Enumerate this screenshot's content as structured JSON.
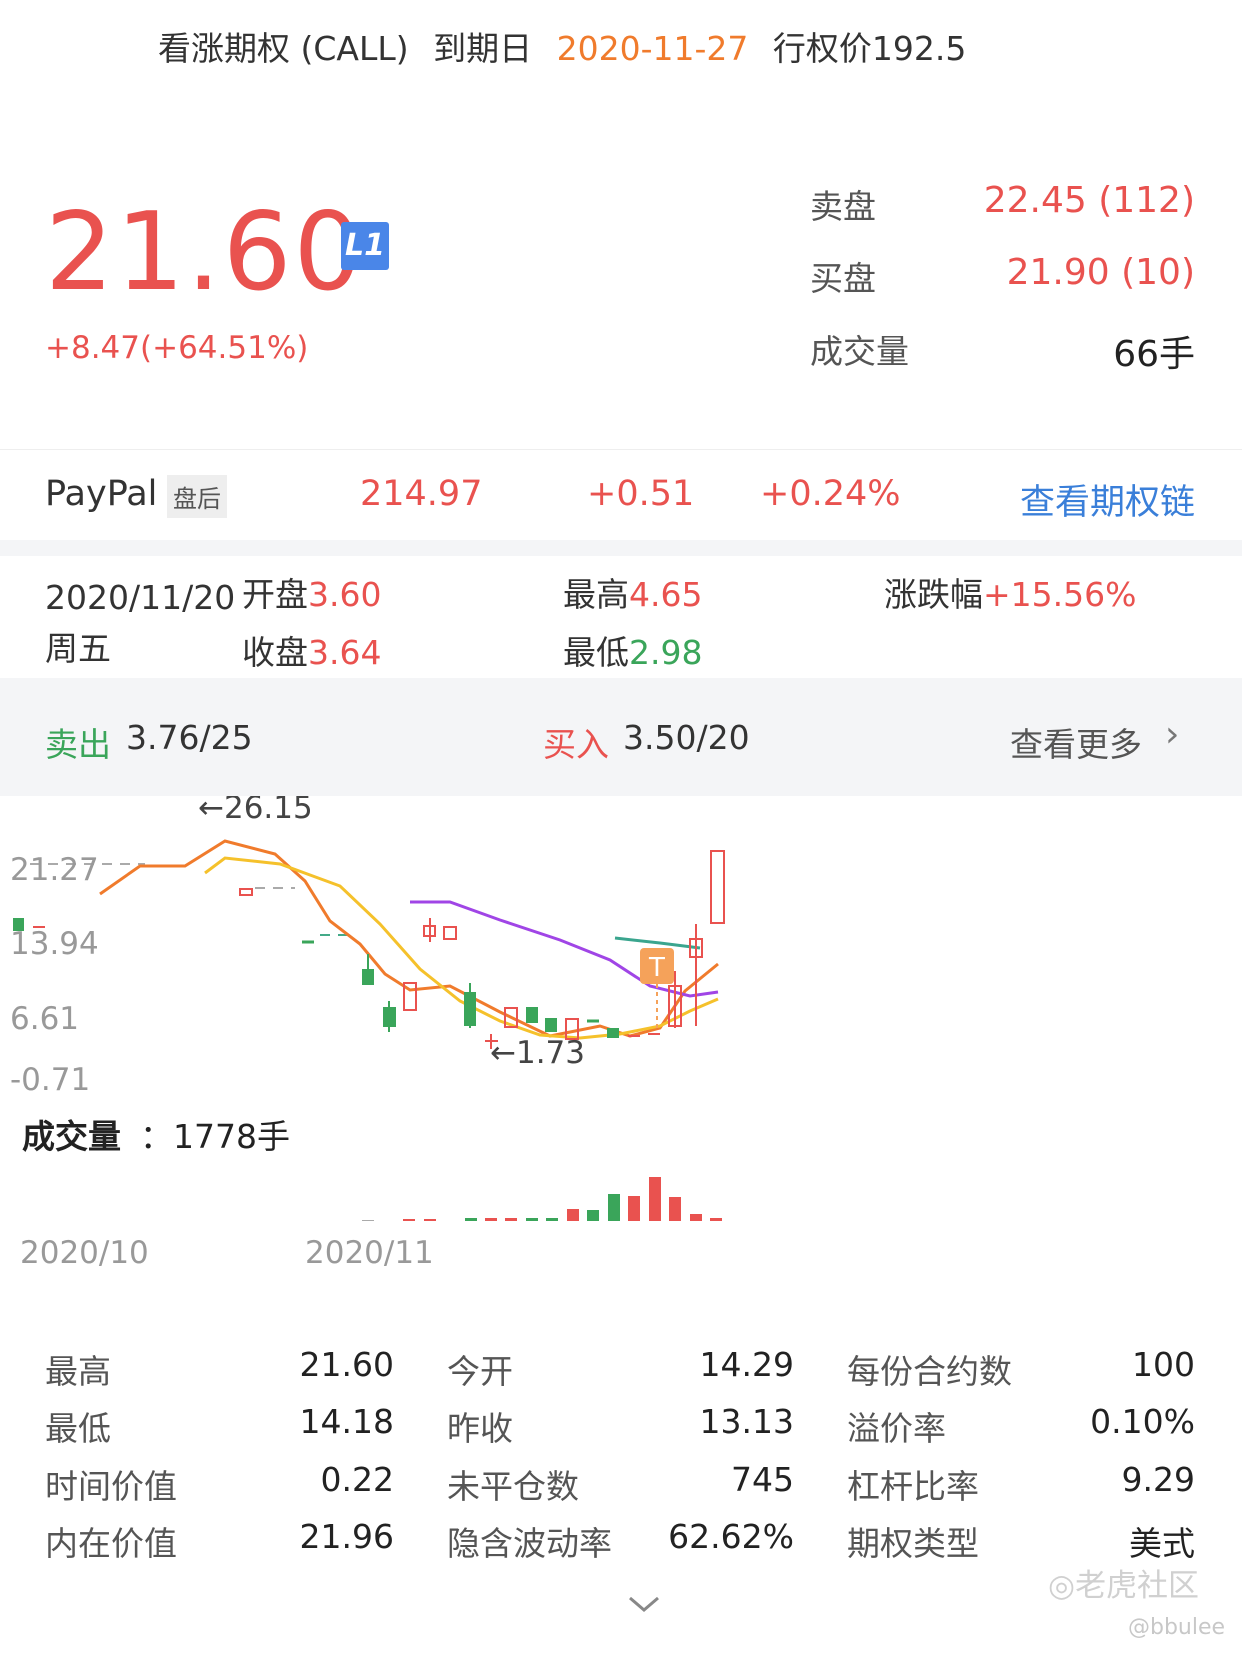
{
  "header": {
    "type_label": "看涨期权 (CALL)",
    "expiry_label": "到期日",
    "expiry_date": "2020-11-27",
    "strike_label": "行权价192.5"
  },
  "quote": {
    "price": "21.60",
    "level_badge": "L1",
    "change": "+8.47(+64.51%)",
    "ask_label": "卖盘",
    "ask_value": "22.45 (112)",
    "bid_label": "买盘",
    "bid_value": "21.90 (10)",
    "volume_label": "成交量",
    "volume_value": "66手"
  },
  "underlying": {
    "name": "PayPal",
    "session_badge": "盘后",
    "price": "214.97",
    "change": "+0.51",
    "change_pct": "+0.24%",
    "chain_link": "查看期权链"
  },
  "daily": {
    "date": "2020/11/20",
    "weekday": "周五",
    "open_label": "开盘",
    "open_value": "3.60",
    "close_label": "收盘",
    "close_value": "3.64",
    "high_label": "最高",
    "high_value": "4.65",
    "low_label": "最低",
    "low_value": "2.98",
    "range_label": "涨跌幅",
    "range_value": "+15.56%"
  },
  "orders": {
    "sell_label": "卖出",
    "sell_value": "3.76/25",
    "buy_label": "买入",
    "buy_value": "3.50/20",
    "more_label": "查看更多"
  },
  "chart": {
    "y_ticks": [
      "21.27",
      "13.94",
      "6.61",
      "-0.71"
    ],
    "max_annotation": "←26.15",
    "min_annotation": "←1.73",
    "trade_marker": "T",
    "volume_label": "成交量",
    "volume_value": "：1778手",
    "x_ticks": [
      "2020/10",
      "2020/11"
    ]
  },
  "chart_data": {
    "type": "candlestick",
    "y_ticks": [
      21.27,
      13.94,
      6.61,
      -0.71
    ],
    "max_value": 26.15,
    "min_value": 1.73,
    "x_ticks": [
      "2020/10",
      "2020/11"
    ],
    "candles": [
      {
        "open": 12.5,
        "close": 12.2,
        "up": false
      },
      {
        "open": 20.0,
        "close": 19.4,
        "up": true
      },
      {
        "open": 15.5,
        "close": 15.1,
        "up": false
      },
      {
        "open": 11.0,
        "close": 9.5,
        "up": false
      },
      {
        "open": 7.6,
        "close": 5.9,
        "up": false
      },
      {
        "open": 7.7,
        "close": 10.2,
        "up": true
      },
      {
        "open": 12.2,
        "close": 13.4,
        "up": true
      },
      {
        "open": 12.2,
        "close": 13.4,
        "up": true
      },
      {
        "open": 9.3,
        "close": 5.8,
        "up": false
      },
      {
        "open": 2.7,
        "close": 2.5,
        "up": true
      },
      {
        "open": 5.9,
        "close": 7.6,
        "up": true
      },
      {
        "open": 7.5,
        "close": 6.0,
        "up": false
      },
      {
        "open": 5.8,
        "close": 4.6,
        "up": false
      },
      {
        "open": 4.5,
        "close": 6.5,
        "up": true
      },
      {
        "open": 5.6,
        "close": 4.6,
        "up": false
      },
      {
        "open": 3.8,
        "close": 3.6,
        "up": false
      },
      {
        "open": 3.6,
        "close": 3.5,
        "up": true
      },
      {
        "open": 3.6,
        "close": 3.64,
        "up": true
      },
      {
        "open": 4.4,
        "close": 8.6,
        "up": true
      },
      {
        "open": 12.6,
        "close": 14.3,
        "up": true
      },
      {
        "open": 14.29,
        "close": 21.6,
        "up": true
      }
    ],
    "volume_total": 1778,
    "volume_unit": "手"
  },
  "stats": [
    {
      "l1": "最高",
      "v1": "21.60",
      "l2": "今开",
      "v2": "14.29",
      "l3": "每份合约数",
      "v3": "100"
    },
    {
      "l1": "最低",
      "v1": "14.18",
      "l2": "昨收",
      "v2": "13.13",
      "l3": "溢价率",
      "v3": "0.10%"
    },
    {
      "l1": "时间价值",
      "v1": "0.22",
      "l2": "未平仓数",
      "v2": "745",
      "l3": "杠杆比率",
      "v3": "9.29"
    },
    {
      "l1": "内在价值",
      "v1": "21.96",
      "l2": "隐含波动率",
      "v2": "62.62%",
      "l3": "期权类型",
      "v3": "美式"
    }
  ],
  "watermark": {
    "brand": "老虎社区",
    "user": "@bbulee"
  },
  "colors": {
    "up": "#e9524f",
    "down": "#3aa55a",
    "accent": "#f07b2c",
    "link": "#3a7fd9"
  }
}
